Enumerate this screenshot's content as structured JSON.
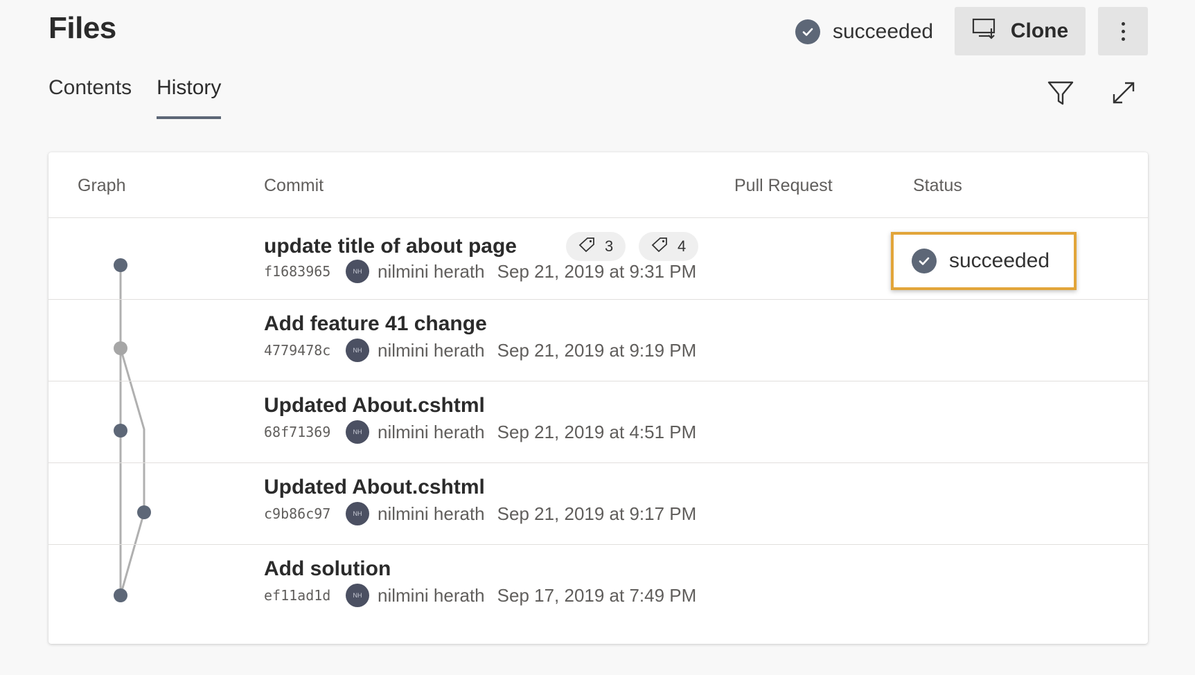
{
  "header": {
    "title": "Files",
    "status_text": "succeeded",
    "clone_label": "Clone",
    "more_icon": "more-vertical-icon",
    "check_icon": "check-circle-icon",
    "clone_icon": "monitor-download-icon"
  },
  "tabs": [
    {
      "label": "Contents",
      "active": false
    },
    {
      "label": "History",
      "active": true
    }
  ],
  "toolbar": {
    "filter_icon": "filter-icon",
    "expand_icon": "expand-icon"
  },
  "table": {
    "columns": [
      "Graph",
      "Commit",
      "Pull Request",
      "Status"
    ],
    "rows": [
      {
        "title": "update title of about page",
        "hash": "f1683965",
        "avatar_initials": "NH",
        "author": "nilmini herath",
        "date": "Sep 21, 2019 at 9:31 PM",
        "tags": [
          "3",
          "4"
        ],
        "status": "succeeded"
      },
      {
        "title": "Add feature 41 change",
        "hash": "4779478c",
        "avatar_initials": "NH",
        "author": "nilmini herath",
        "date": "Sep 21, 2019 at 9:19 PM"
      },
      {
        "title": "Updated About.cshtml",
        "hash": "68f71369",
        "avatar_initials": "NH",
        "author": "nilmini herath",
        "date": "Sep 21, 2019 at 4:51 PM"
      },
      {
        "title": "Updated About.cshtml",
        "hash": "c9b86c97",
        "avatar_initials": "NH",
        "author": "nilmini herath",
        "date": "Sep 21, 2019 at 9:17 PM"
      },
      {
        "title": "Add solution",
        "hash": "ef11ad1d",
        "avatar_initials": "NH",
        "author": "nilmini herath",
        "date": "Sep 17, 2019 at 7:49 PM"
      }
    ]
  },
  "colors": {
    "accent": "#5d6777",
    "highlight": "#e2a53a",
    "graph_line": "#b0b0b0",
    "graph_node": "#5d6777"
  }
}
